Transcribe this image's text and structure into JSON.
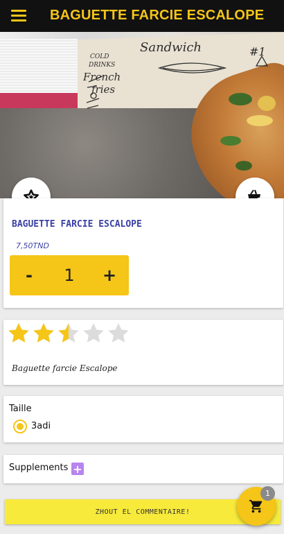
{
  "app_bar": {
    "title": "BAGUETTE FARCIE ESCALOPE",
    "menu_icon": "hamburger-menu-icon",
    "background": "#111111",
    "title_color": "#f5c518"
  },
  "hero": {
    "image": "baguette-sandwich-photo",
    "favorite_icon": "star-outline-icon",
    "add_to_basket_icon": "basket-add-icon"
  },
  "product": {
    "name": "BAGUETTE FARCIE ESCALOPE",
    "price": "7,50TND",
    "quantity": {
      "decrement_label": "-",
      "value": "1",
      "increment_label": "+"
    }
  },
  "rating": {
    "value": 2.5,
    "max": 5,
    "star_color": "#f5c518",
    "empty_color": "#dcdcdc"
  },
  "description": "Baguette farcie Escalope",
  "size_section": {
    "label": "Taille",
    "options": [
      {
        "label": "3adi",
        "selected": true
      }
    ]
  },
  "supplements_section": {
    "label": "Supplements",
    "add_icon": "plus-icon",
    "add_color": "#b884f0"
  },
  "comment_button": {
    "label": "ZHOUT EL COMMENTAIRE!"
  },
  "cart": {
    "icon": "shopping-cart-icon",
    "count": "1",
    "color": "#f5c518"
  }
}
